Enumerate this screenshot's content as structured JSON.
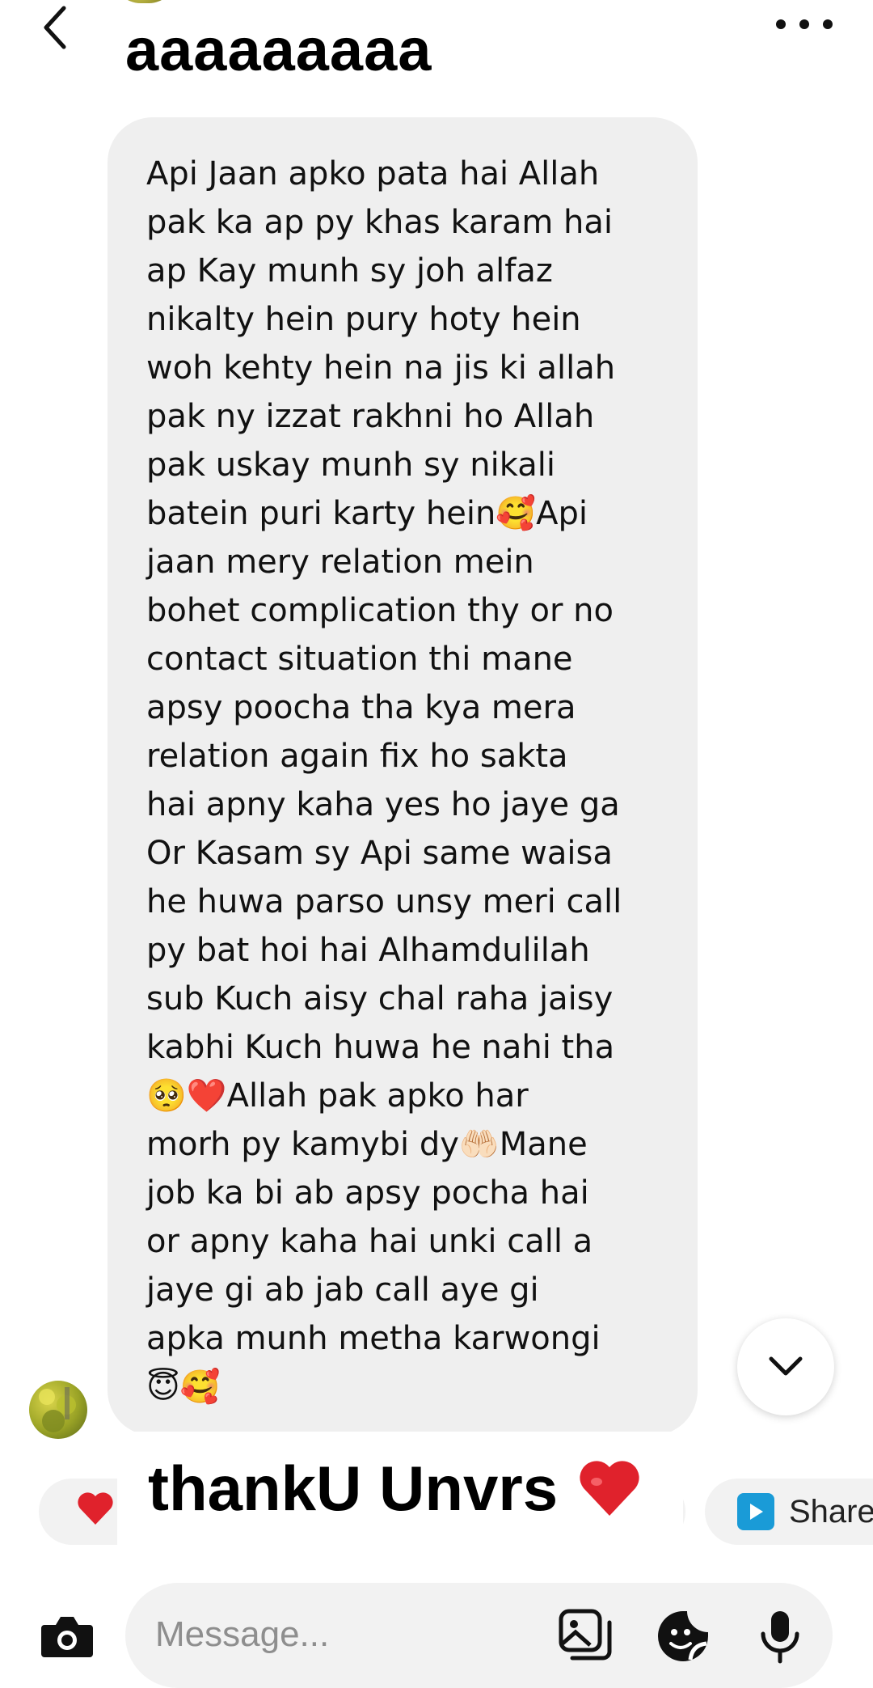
{
  "header": {
    "title": "aaaaaaaaa"
  },
  "message": {
    "text": "Api Jaan apko pata hai Allah\npak ka ap py khas karam hai\nap Kay munh sy joh alfaz\nnikalty hein pury hoty hein\nwoh kehty hein na jis ki allah\npak ny izzat rakhni ho Allah\npak uskay munh sy nikali\nbatein puri karty hein🥰Api\njaan mery relation mein\nbohet complication thy or no\ncontact situation thi mane\napsy poocha tha kya mera\nrelation again fix ho sakta\nhai apny kaha yes ho jaye ga\nOr Kasam sy Api same waisa\nhe huwa parso unsy meri call\npy bat hoi hai Alhamdulilah\nsub Kuch  aisy chal raha jaisy\nkabhi Kuch huwa he nahi tha\n🥺❤️Allah pak apko har\nmorh py kamybi dy🤲🏻Mane\njob ka bi ab apsy pocha hai\nor apny kaha hai unki call a\njaye gi ab jab call aye gi\napka munh metha karwongi\n😇🥰"
  },
  "caption": {
    "text": "thankU Unvrs"
  },
  "reactions": {
    "share_label": "Share"
  },
  "composer": {
    "placeholder": "Message..."
  },
  "colors": {
    "bubble": "#efefef",
    "heart": "#e0222c",
    "share": "#1a9bd7"
  },
  "icons": [
    "back-icon",
    "more-icon",
    "chevron-down-icon",
    "heart-icon",
    "share-icon",
    "camera-icon",
    "gallery-icon",
    "sticker-icon",
    "mic-icon"
  ]
}
